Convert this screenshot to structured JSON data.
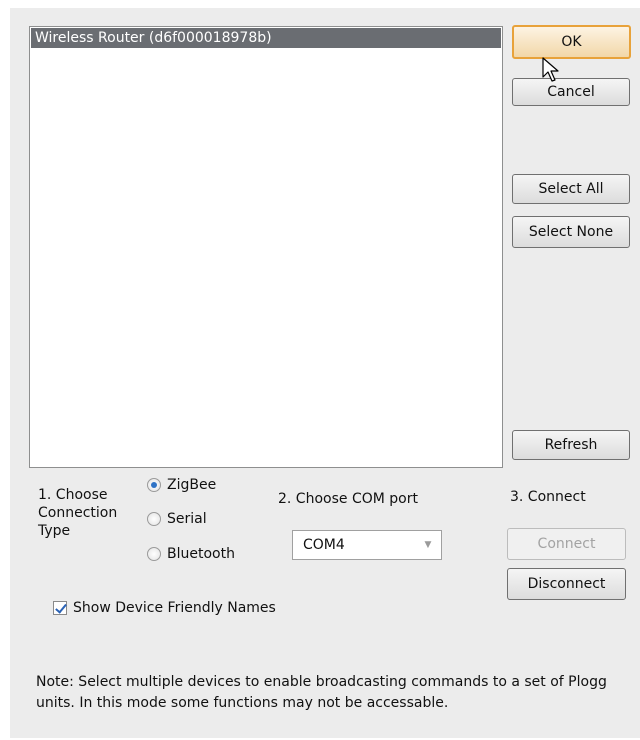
{
  "device_list": {
    "items": [
      "Wireless Router (d6f000018978b)"
    ]
  },
  "buttons": {
    "ok": "OK",
    "cancel": "Cancel",
    "select_all": "Select All",
    "select_none": "Select None",
    "refresh": "Refresh",
    "connect": "Connect",
    "disconnect": "Disconnect"
  },
  "connection_type": {
    "label_line1": "1. Choose",
    "label_line2": "Connection",
    "label_line3": "Type",
    "options": [
      "ZigBee",
      "Serial",
      "Bluetooth"
    ],
    "selected": "ZigBee"
  },
  "com_port": {
    "label": "2. Choose COM port",
    "selected": "COM4"
  },
  "connect_section": {
    "label": "3. Connect"
  },
  "friendly_names": {
    "label": "Show Device Friendly Names",
    "checked": true
  },
  "note": {
    "text": "Note: Select multiple devices to enable broadcasting commands to a set of Plogg units. In this mode some functions may not be accessable."
  },
  "colors": {
    "selection": "#6a6d72",
    "default_button_border": "#e8a23a",
    "radio_accent": "#2f73c6"
  }
}
